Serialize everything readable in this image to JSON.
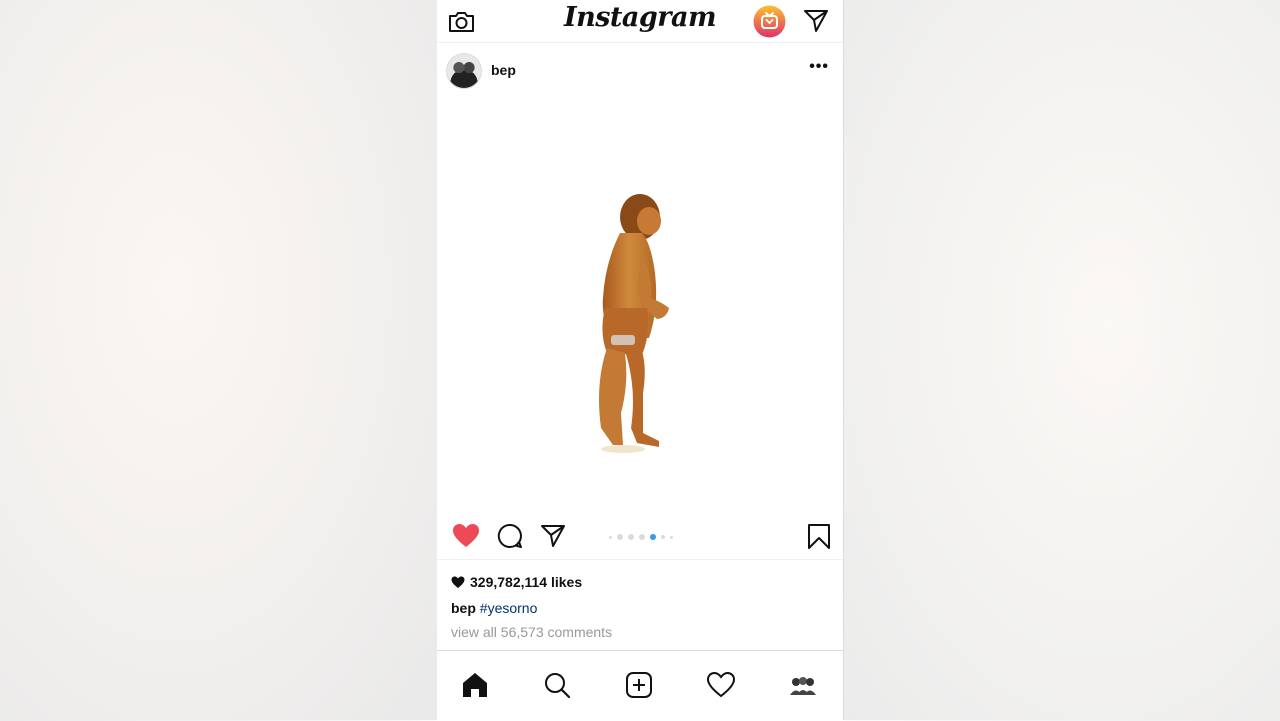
{
  "header": {
    "logo": "Instagram",
    "camera_icon": "camera-icon",
    "igtv_icon": "igtv-icon",
    "direct_icon": "paper-plane-icon"
  },
  "post": {
    "username": "bep",
    "more_label": "•••",
    "likes_count": "329,782,114 likes",
    "caption_user": "bep",
    "caption_hashtag": "#yesorno",
    "comments_link": "view all 56,573 comments",
    "carousel": {
      "total": 7,
      "active_index": 4
    }
  },
  "colors": {
    "like_red": "#ed4956",
    "accent_blue": "#3897f0",
    "hashtag_blue": "#003569",
    "igtv_gradient": [
      "#f9c22e",
      "#e1306c"
    ]
  },
  "tabbar": {
    "items": [
      "home-icon",
      "search-icon",
      "add-post-icon",
      "activity-heart-icon",
      "profile-avatar"
    ]
  }
}
